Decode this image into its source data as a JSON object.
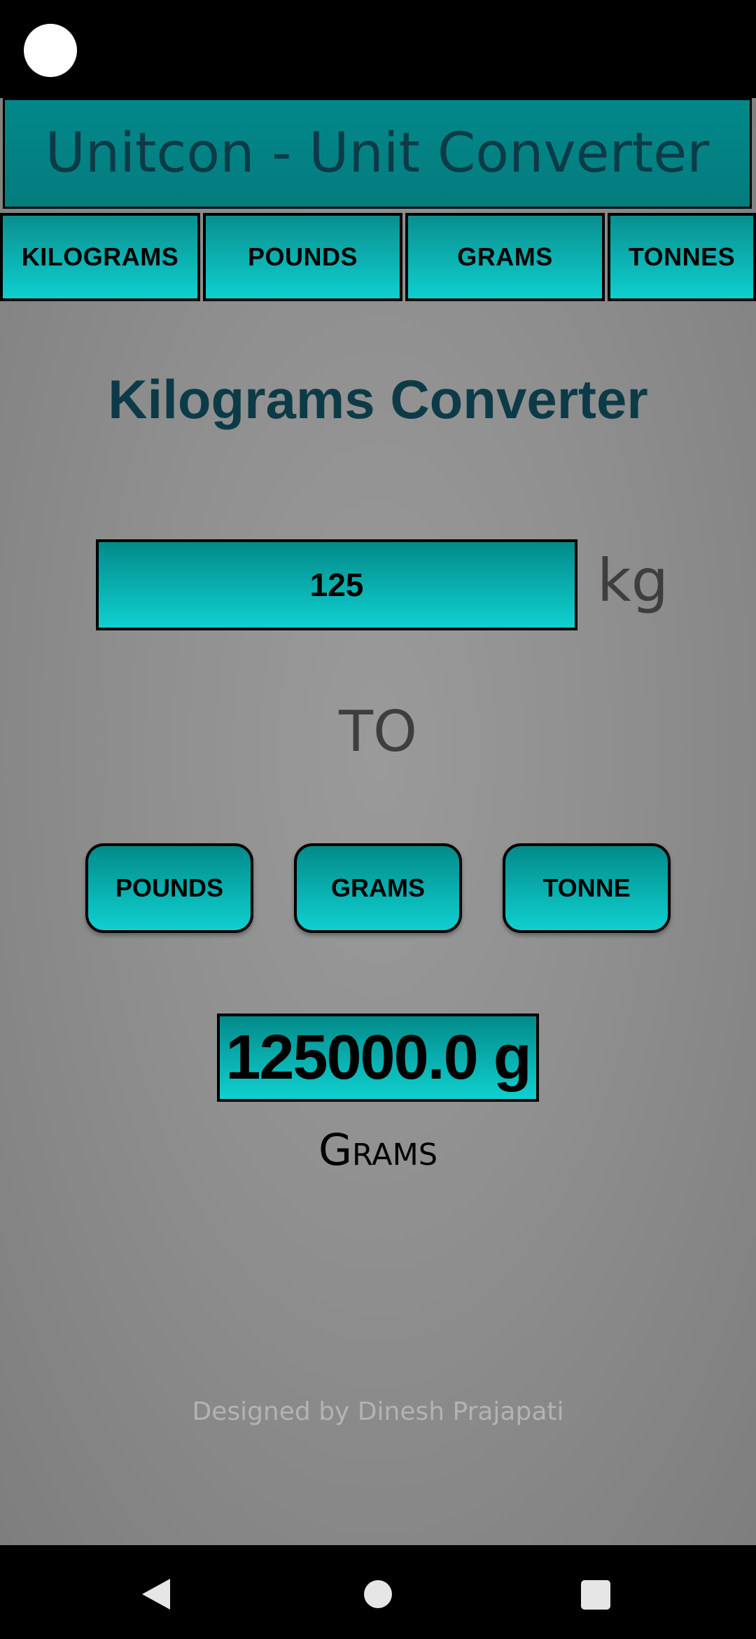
{
  "app": {
    "title": "Unitcon - Unit Converter"
  },
  "tabs": [
    {
      "label": "KILOGRAMS"
    },
    {
      "label": "POUNDS"
    },
    {
      "label": "GRAMS"
    },
    {
      "label": "TONNES"
    }
  ],
  "converter": {
    "title": "Kilograms Converter",
    "input_value": "125",
    "input_unit": "kg",
    "to_label": "TO",
    "target_buttons": [
      {
        "label": "POUNDS"
      },
      {
        "label": "GRAMS"
      },
      {
        "label": "TONNE"
      }
    ],
    "result_value": "125000.0 g",
    "result_unit_name": "Grams"
  },
  "footer": {
    "credit": "Designed by Dinesh Prajapati"
  },
  "colors": {
    "accent": "#0fcfcf",
    "accent_dark": "#02888a",
    "title_text": "#0c3b47",
    "background": "#8f8f8f"
  },
  "icons": {
    "nav_back": "back-triangle-icon",
    "nav_home": "home-circle-icon",
    "nav_recents": "recents-square-icon",
    "camera": "camera-cutout-icon"
  }
}
